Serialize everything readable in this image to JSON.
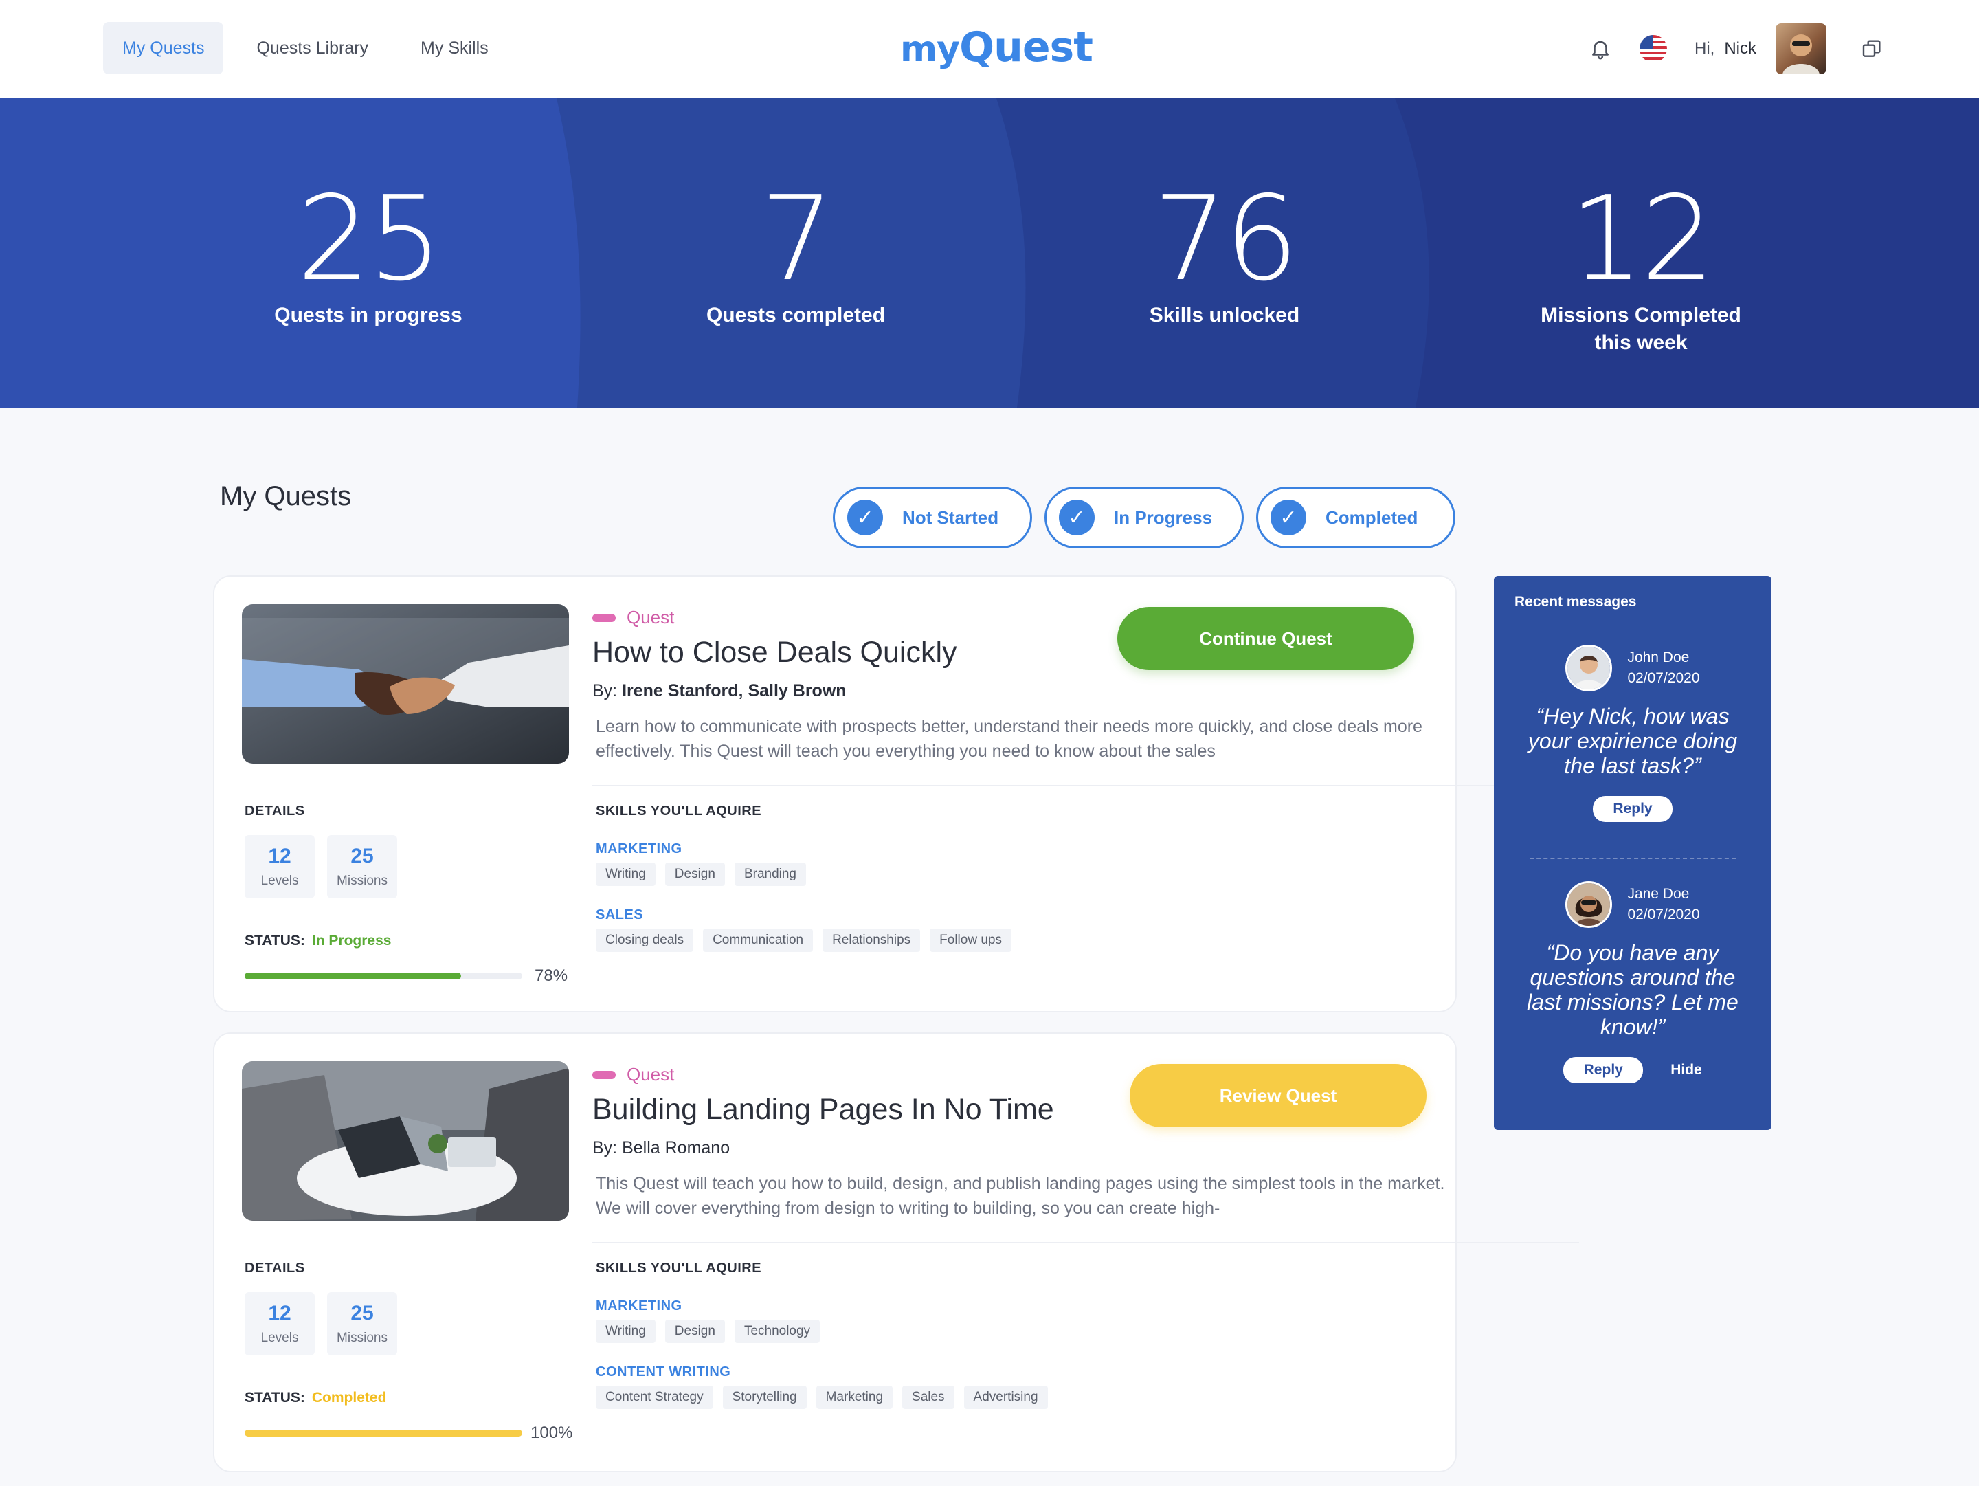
{
  "header": {
    "nav": [
      {
        "label": "My Quests",
        "active": true
      },
      {
        "label": "Quests Library",
        "active": false
      },
      {
        "label": "My Skills",
        "active": false
      }
    ],
    "logo": {
      "prefix": "my",
      "suffix": "Quest"
    },
    "greeting_prefix": "Hi,",
    "user_name": "Nick"
  },
  "stats": [
    {
      "value": "25",
      "label": "Quests in progress"
    },
    {
      "value": "7",
      "label": "Quests completed"
    },
    {
      "value": "76",
      "label": "Skills unlocked"
    },
    {
      "value": "12",
      "label": "Missions Completed this week"
    }
  ],
  "section_title": "My Quests",
  "filters": [
    {
      "label": "Not Started",
      "checked": true
    },
    {
      "label": "In Progress",
      "checked": true
    },
    {
      "label": "Completed",
      "checked": true
    }
  ],
  "quests": [
    {
      "tag": "Quest",
      "title": "How to Close Deals Quickly",
      "by_prefix": "By:",
      "authors": "Irene Stanford, Sally Brown",
      "description": "Learn how to communicate with prospects better, understand their needs more quickly, and close deals more effectively. This Quest will teach you everything you need to know about the sales",
      "cta": "Continue Quest",
      "details_heading": "DETAILS",
      "levels": "12",
      "levels_label": "Levels",
      "missions": "25",
      "missions_label": "Missions",
      "status_label": "STATUS:",
      "status": "In Progress",
      "progress": 78,
      "progress_text": "78%",
      "skills_heading": "SKILLS YOU'LL AQUIRE",
      "skill_groups": [
        {
          "name": "MARKETING",
          "skills": [
            "Writing",
            "Design",
            "Branding"
          ]
        },
        {
          "name": "SALES",
          "skills": [
            "Closing deals",
            "Communication",
            "Relationships",
            "Follow ups"
          ]
        }
      ]
    },
    {
      "tag": "Quest",
      "title": "Building Landing Pages In No Time",
      "by_prefix": "By:",
      "authors": "Bella Romano",
      "description": "This Quest will teach you how to build, design, and publish landing pages using the simplest tools in the market. We will cover everything from design to writing to building, so you can create high-",
      "cta": "Review Quest",
      "details_heading": "DETAILS",
      "levels": "12",
      "levels_label": "Levels",
      "missions": "25",
      "missions_label": "Missions",
      "status_label": "STATUS:",
      "status": "Completed",
      "progress": 100,
      "progress_text": "100%",
      "skills_heading": "SKILLS YOU'LL AQUIRE",
      "skill_groups": [
        {
          "name": "MARKETING",
          "skills": [
            "Writing",
            "Design",
            "Technology"
          ]
        },
        {
          "name": "CONTENT WRITING",
          "skills": [
            "Content Strategy",
            "Storytelling",
            "Marketing",
            "Sales",
            "Advertising"
          ]
        }
      ]
    }
  ],
  "messages": {
    "heading": "Recent messages",
    "items": [
      {
        "name": "John Doe",
        "date": "02/07/2020",
        "text": "“Hey Nick, how was your expirience doing the last task?”",
        "reply": "Reply",
        "hide": ""
      },
      {
        "name": "Jane Doe",
        "date": "02/07/2020",
        "text": "“Do you have any questions around the last missions? Let me know!”",
        "reply": "Reply",
        "hide": "Hide"
      }
    ]
  },
  "colors": {
    "accent": "#3b82e0",
    "banner_dark": "#24398a",
    "green": "#5aab36",
    "yellow": "#f7cc45",
    "tag_pink": "#d05ca7"
  },
  "icons": [
    "bell-icon",
    "us-flag-icon",
    "window-icon",
    "check-icon"
  ]
}
